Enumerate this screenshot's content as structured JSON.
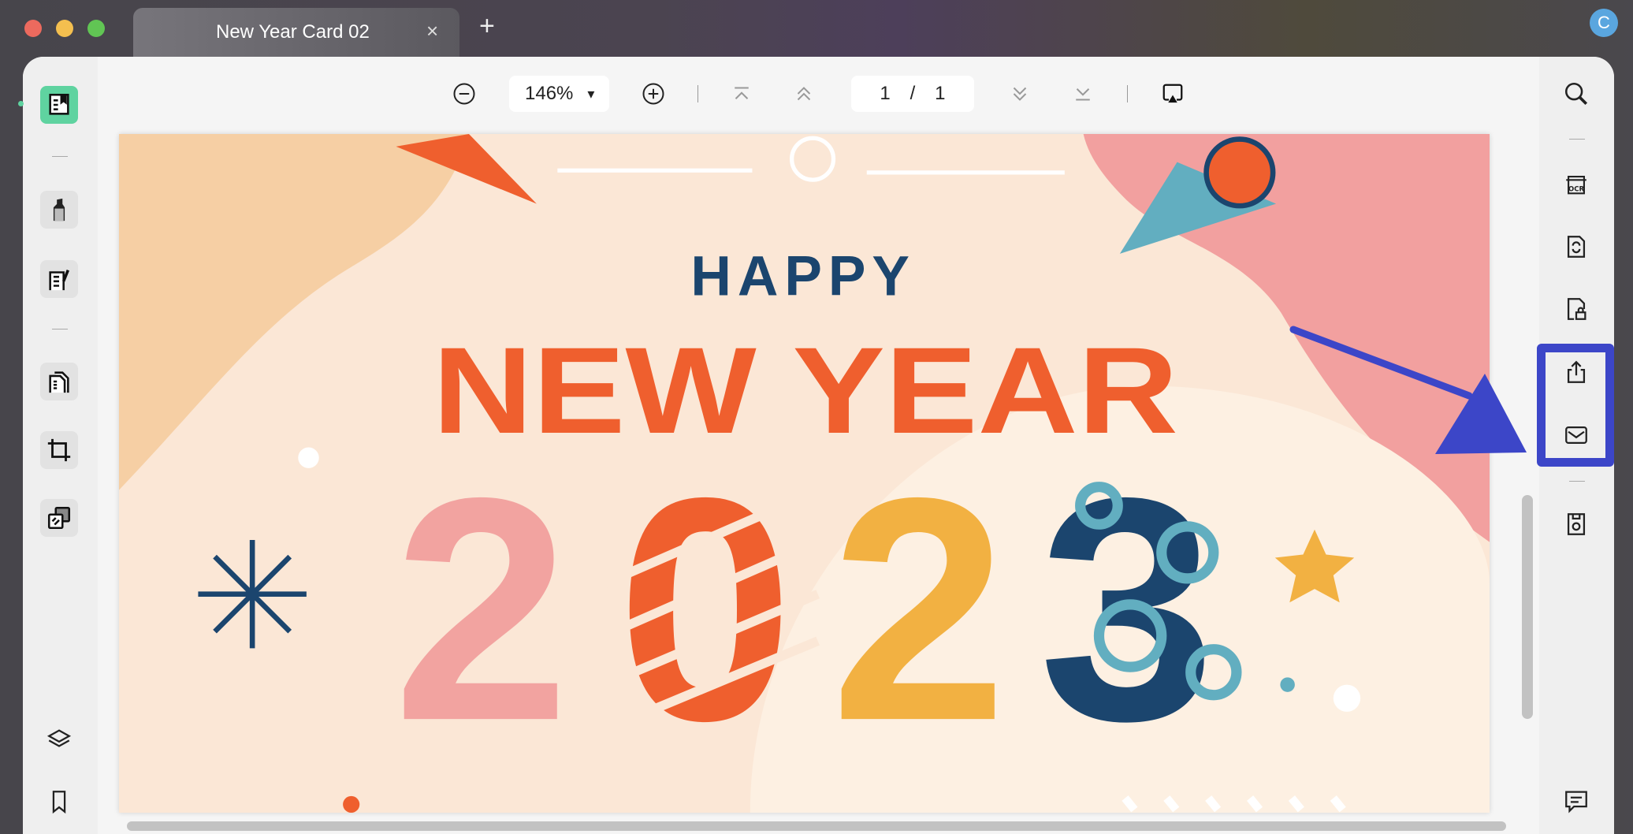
{
  "window": {
    "traffic_lights": {
      "close": "#ec6a5e",
      "minimize": "#f4bf4f",
      "zoom": "#61c554"
    }
  },
  "tabs": [
    {
      "title": "New Year Card 02",
      "close": "×"
    }
  ],
  "new_tab": "+",
  "account": {
    "initial": "C",
    "color": "#5aa6df"
  },
  "toolbar": {
    "zoom_level": "146%",
    "zoom_dropdown": "▾",
    "page_current": "1",
    "page_separator": "/",
    "page_total": "1"
  },
  "left_sidebar": {
    "items": [
      {
        "icon": "reader-icon",
        "active": true,
        "accent": "#5fd3a0"
      },
      {
        "icon": "highlighter-icon"
      },
      {
        "icon": "edit-pdf-icon"
      },
      {
        "icon": "organize-pages-icon"
      },
      {
        "icon": "crop-icon"
      },
      {
        "icon": "batch-icon"
      },
      {
        "icon": "layers-icon"
      },
      {
        "icon": "bookmark-icon"
      }
    ]
  },
  "right_sidebar": {
    "items": [
      {
        "icon": "search-icon"
      },
      {
        "icon": "ocr-icon",
        "label": "OCR"
      },
      {
        "icon": "convert-icon"
      },
      {
        "icon": "protect-icon"
      },
      {
        "icon": "share-icon"
      },
      {
        "icon": "email-icon"
      },
      {
        "icon": "save-icon"
      },
      {
        "icon": "comment-icon"
      }
    ],
    "highlight_color": "#3c46c8"
  },
  "document": {
    "happy": "HAPPY",
    "new_year": "NEW YEAR",
    "year_digits": [
      "2",
      "0",
      "2",
      "3"
    ],
    "colors": {
      "navy": "#1b456e",
      "orange": "#ef5f2e",
      "pink": "#f2a3a0",
      "yellow": "#f2b142",
      "teal": "#62aec0",
      "background": "#fbe7d6"
    }
  }
}
